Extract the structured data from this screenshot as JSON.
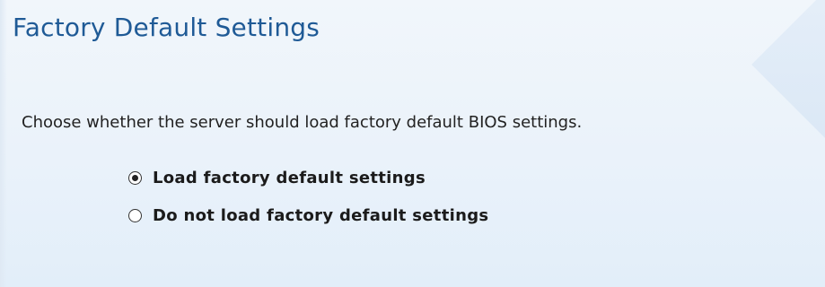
{
  "page": {
    "title": "Factory Default Settings",
    "description": "Choose whether the server should load factory default BIOS settings."
  },
  "options": [
    {
      "label": "Load factory default settings",
      "selected": true
    },
    {
      "label": "Do not load factory default settings",
      "selected": false
    }
  ],
  "colors": {
    "title": "#1f5a96",
    "background": "#eaf2fa"
  }
}
